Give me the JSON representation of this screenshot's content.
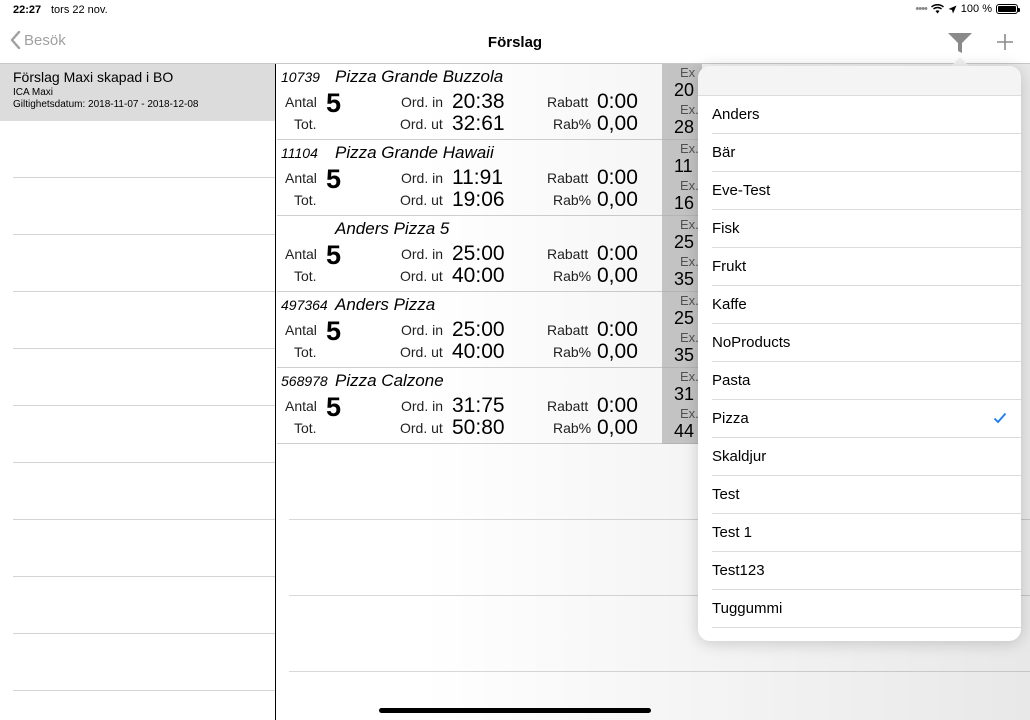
{
  "status": {
    "time": "22:27",
    "date": "tors 22 nov.",
    "battery": "100 %"
  },
  "nav": {
    "back_label": "Besök",
    "title": "Förslag"
  },
  "left": {
    "selected": {
      "title": "Förslag Maxi skapad i BO",
      "store": "ICA Maxi",
      "validity": "Giltighetsdatum: 2018-11-07 - 2018-12-08"
    }
  },
  "labels": {
    "antal": "Antal",
    "tot": "Tot.",
    "ord_in": "Ord. in",
    "ord_ut": "Ord. ut",
    "rabatt": "Rabatt",
    "rab_pct": "Rab%",
    "ex": "Ex.",
    "ex_short": "Ex"
  },
  "products": [
    {
      "number": "10739",
      "name": "Pizza Grande Buzzola",
      "antal": "5",
      "ord_in": "20:38",
      "ord_ut": "32:61",
      "rabatt": "0:00",
      "rab_pct": "0,00",
      "ex1": "20",
      "ex2": "28"
    },
    {
      "number": "11104",
      "name": "Pizza Grande Hawaii",
      "antal": "5",
      "ord_in": "11:91",
      "ord_ut": "19:06",
      "rabatt": "0:00",
      "rab_pct": "0,00",
      "ex1": "11",
      "ex2": "16"
    },
    {
      "number": "",
      "name": "Anders Pizza 5",
      "antal": "5",
      "ord_in": "25:00",
      "ord_ut": "40:00",
      "rabatt": "0:00",
      "rab_pct": "0,00",
      "ex1": "25",
      "ex2": "35"
    },
    {
      "number": "497364",
      "name": "Anders Pizza",
      "antal": "5",
      "ord_in": "25:00",
      "ord_ut": "40:00",
      "rabatt": "0:00",
      "rab_pct": "0,00",
      "ex1": "25",
      "ex2": "35"
    },
    {
      "number": "568978",
      "name": "Pizza Calzone",
      "antal": "5",
      "ord_in": "31:75",
      "ord_ut": "50:80",
      "rabatt": "0:00",
      "rab_pct": "0,00",
      "ex1": "31",
      "ex2": "44"
    }
  ],
  "filter": {
    "items": [
      "Anders",
      "Bär",
      "Eve-Test",
      "Fisk",
      "Frukt",
      "Kaffe",
      "NoProducts",
      "Pasta",
      "Pizza",
      "Skaldjur",
      "Test",
      "Test 1",
      "Test123",
      "Tuggummi"
    ],
    "selected": "Pizza",
    "check_color": "#1a7cf5"
  }
}
